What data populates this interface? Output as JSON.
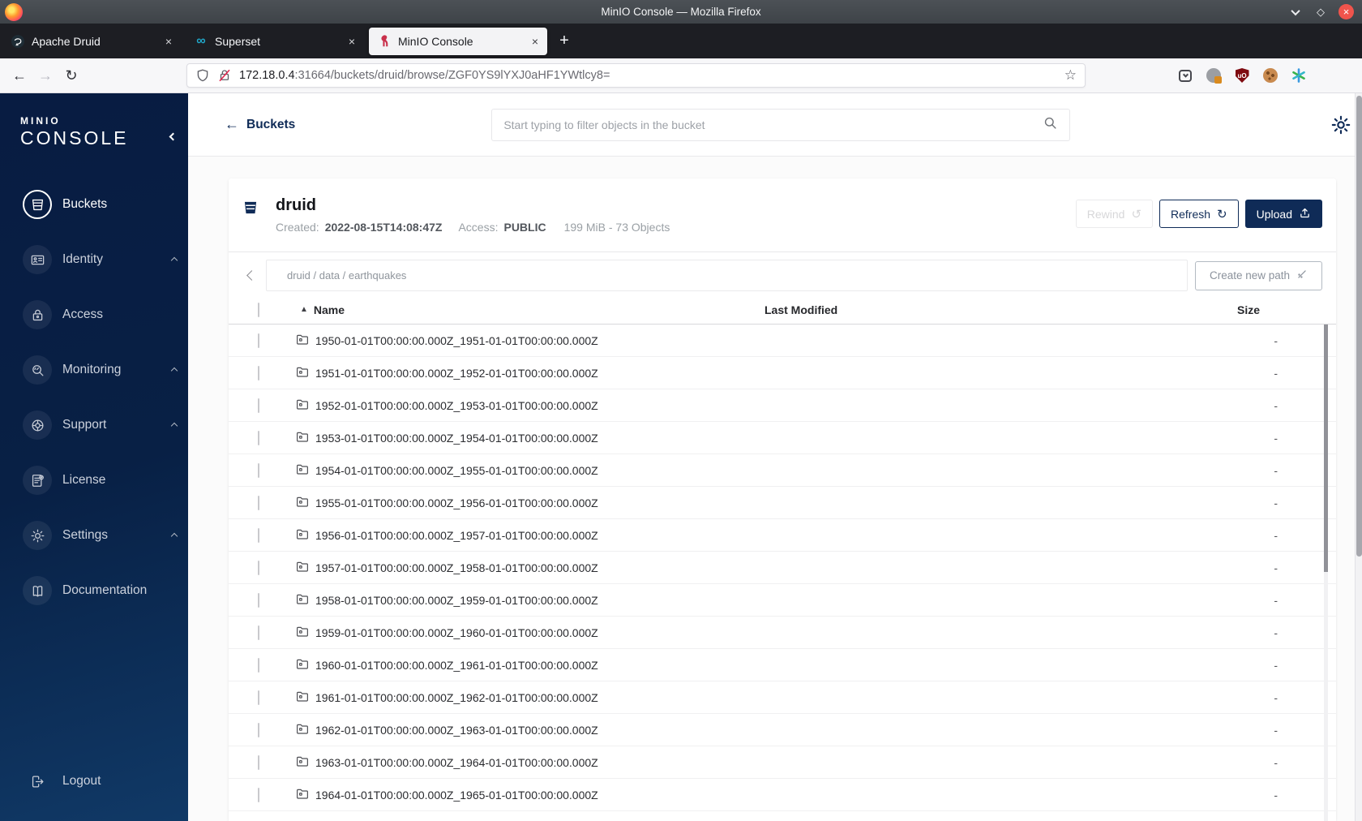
{
  "titlebar": {
    "title": "MinIO Console — Mozilla Firefox"
  },
  "tabs": [
    {
      "label": "Apache Druid"
    },
    {
      "label": "Superset"
    },
    {
      "label": "MinIO Console"
    }
  ],
  "glyphs": {
    "back": "←",
    "forward": "→",
    "reload": "↻",
    "star": "☆",
    "new_tab": "+",
    "close_tab": "×",
    "window_close": "×",
    "maximize": "◇",
    "rewind": "↺",
    "refresh": "↻",
    "sort_asc": "▲",
    "superset": "∞"
  },
  "urlbar": {
    "url_host": "172.18.0.4",
    "url_path": ":31664/buckets/druid/browse/ZGF0YS9lYXJ0aHF1YWtlcy8="
  },
  "sidebar": {
    "brand_top": "MINIO",
    "brand_bottom": "CONSOLE",
    "items": [
      {
        "label": "Buckets",
        "icon": "bucket-icon",
        "active": true,
        "caret": false
      },
      {
        "label": "Identity",
        "icon": "identity-icon",
        "active": false,
        "caret": true
      },
      {
        "label": "Access",
        "icon": "lock-icon",
        "active": false,
        "caret": false
      },
      {
        "label": "Monitoring",
        "icon": "monitoring-icon",
        "active": false,
        "caret": true
      },
      {
        "label": "Support",
        "icon": "support-icon",
        "active": false,
        "caret": true
      },
      {
        "label": "License",
        "icon": "license-icon",
        "active": false,
        "caret": false
      },
      {
        "label": "Settings",
        "icon": "settings-icon",
        "active": false,
        "caret": true
      },
      {
        "label": "Documentation",
        "icon": "documentation-icon",
        "active": false,
        "caret": false
      }
    ],
    "logout_label": "Logout"
  },
  "header": {
    "back_label": "Buckets",
    "search_placeholder": "Start typing to filter objects in the bucket"
  },
  "bucket": {
    "name": "druid",
    "created_label": "Created:",
    "created_value": "2022-08-15T14:08:47Z",
    "access_label": "Access:",
    "access_value": "PUBLIC",
    "summary": "199 MiB - 73 Objects",
    "rewind_label": "Rewind",
    "refresh_label": "Refresh",
    "upload_label": "Upload"
  },
  "path_bar": {
    "path": "druid / data / earthquakes",
    "create_button": "Create new path"
  },
  "table": {
    "columns": {
      "name": "Name",
      "last_modified": "Last Modified",
      "size": "Size"
    },
    "rows": [
      {
        "name": "1950-01-01T00:00:00.000Z_1951-01-01T00:00:00.000Z",
        "last_modified": "",
        "size": "-"
      },
      {
        "name": "1951-01-01T00:00:00.000Z_1952-01-01T00:00:00.000Z",
        "last_modified": "",
        "size": "-"
      },
      {
        "name": "1952-01-01T00:00:00.000Z_1953-01-01T00:00:00.000Z",
        "last_modified": "",
        "size": "-"
      },
      {
        "name": "1953-01-01T00:00:00.000Z_1954-01-01T00:00:00.000Z",
        "last_modified": "",
        "size": "-"
      },
      {
        "name": "1954-01-01T00:00:00.000Z_1955-01-01T00:00:00.000Z",
        "last_modified": "",
        "size": "-"
      },
      {
        "name": "1955-01-01T00:00:00.000Z_1956-01-01T00:00:00.000Z",
        "last_modified": "",
        "size": "-"
      },
      {
        "name": "1956-01-01T00:00:00.000Z_1957-01-01T00:00:00.000Z",
        "last_modified": "",
        "size": "-"
      },
      {
        "name": "1957-01-01T00:00:00.000Z_1958-01-01T00:00:00.000Z",
        "last_modified": "",
        "size": "-"
      },
      {
        "name": "1958-01-01T00:00:00.000Z_1959-01-01T00:00:00.000Z",
        "last_modified": "",
        "size": "-"
      },
      {
        "name": "1959-01-01T00:00:00.000Z_1960-01-01T00:00:00.000Z",
        "last_modified": "",
        "size": "-"
      },
      {
        "name": "1960-01-01T00:00:00.000Z_1961-01-01T00:00:00.000Z",
        "last_modified": "",
        "size": "-"
      },
      {
        "name": "1961-01-01T00:00:00.000Z_1962-01-01T00:00:00.000Z",
        "last_modified": "",
        "size": "-"
      },
      {
        "name": "1962-01-01T00:00:00.000Z_1963-01-01T00:00:00.000Z",
        "last_modified": "",
        "size": "-"
      },
      {
        "name": "1963-01-01T00:00:00.000Z_1964-01-01T00:00:00.000Z",
        "last_modified": "",
        "size": "-"
      },
      {
        "name": "1964-01-01T00:00:00.000Z_1965-01-01T00:00:00.000Z",
        "last_modified": "",
        "size": "-"
      }
    ]
  }
}
